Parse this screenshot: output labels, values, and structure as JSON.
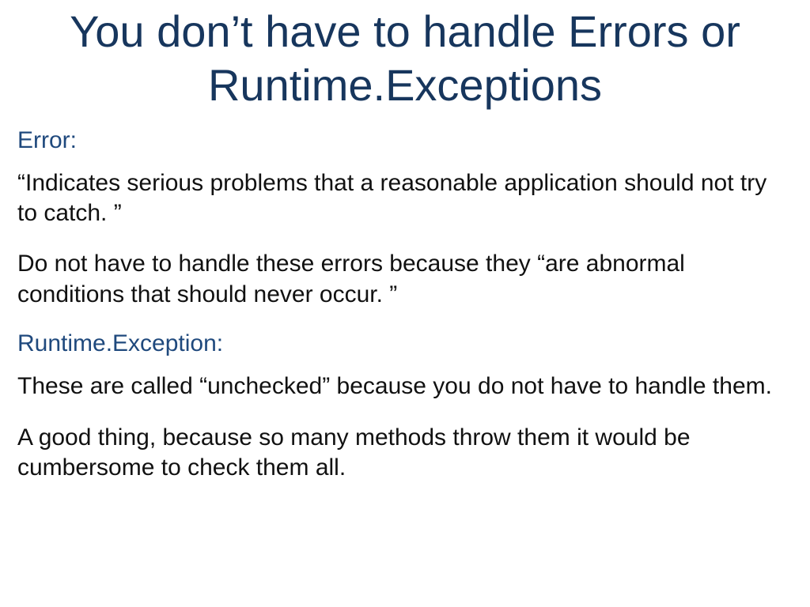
{
  "title": "You don’t have to handle Errors or Runtime.Exceptions",
  "sections": {
    "error": {
      "label": "Error:",
      "p1": "“Indicates serious problems that a reasonable application should not try to catch. ”",
      "p2": "Do not have to handle these errors because they “are abnormal conditions that should never occur. ”"
    },
    "runtime": {
      "label": "Runtime.Exception:",
      "p1": "These are called “unchecked” because you do not have to handle them.",
      "p2": "A good thing, because so many methods throw them it would be cumbersome to check them all."
    }
  }
}
